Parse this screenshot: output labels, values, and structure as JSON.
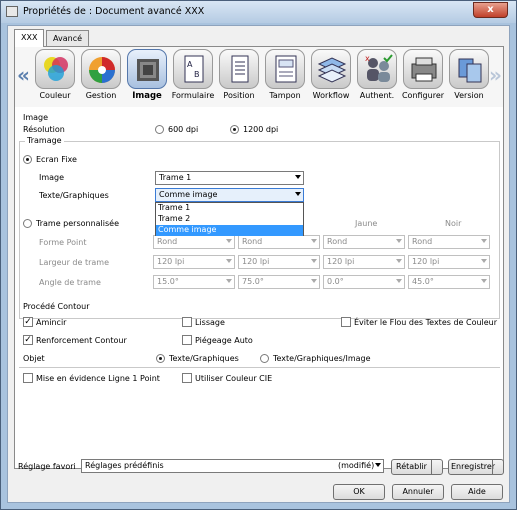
{
  "window": {
    "title": "Propriétés de : Document avancé XXX",
    "close_glyph": "x"
  },
  "tabs": [
    {
      "label": "XXX"
    },
    {
      "label": "Avancé"
    }
  ],
  "toolbar": {
    "prev_glyph": "«",
    "next_glyph": "»",
    "items": [
      {
        "label": "Couleur",
        "icon": "color-circles-icon"
      },
      {
        "label": "Gestion",
        "icon": "color-wheel-icon"
      },
      {
        "label": "Image",
        "icon": "image-halftone-icon"
      },
      {
        "label": "Formulaire",
        "icon": "form-icon"
      },
      {
        "label": "Position",
        "icon": "position-icon"
      },
      {
        "label": "Tampon",
        "icon": "stamp-icon"
      },
      {
        "label": "Workflow",
        "icon": "workflow-icon"
      },
      {
        "label": "Authent.",
        "icon": "users-icon"
      },
      {
        "label": "Configurer",
        "icon": "printer-icon"
      },
      {
        "label": "Version",
        "icon": "version-icon"
      }
    ]
  },
  "image_section": {
    "heading": "Image",
    "resolution_label": "Résolution",
    "res_600": "600 dpi",
    "res_1200": "1200 dpi",
    "tramage": {
      "heading": "Tramage",
      "ecran_fixe": "Ecran Fixe",
      "image_label": "Image",
      "image_value": "Trame 1",
      "texte_label": "Texte/Graphiques",
      "texte_value": "Comme image",
      "dropdown_options": [
        "Trame 1",
        "Trame 2",
        "Comme image"
      ],
      "custom": "Trame personnalisée",
      "col_jaune": "Jaune",
      "col_noir": "Noir",
      "rows": [
        {
          "label": "Forme Point",
          "values": [
            "Rond",
            "Rond",
            "Rond",
            "Rond"
          ]
        },
        {
          "label": "Largeur de trame",
          "values": [
            "120 lpi",
            "120 lpi",
            "120 lpi",
            "120 lpi"
          ]
        },
        {
          "label": "Angle de trame",
          "values": [
            "15.0°",
            "75.0°",
            "0.0°",
            "45.0°"
          ]
        }
      ]
    }
  },
  "contour": {
    "heading": "Procédé Contour",
    "amincir": "Amincir",
    "lissage": "Lissage",
    "eviter": "Éviter le Flou des Textes de Couleur",
    "renforcement": "Renforcement Contour",
    "piegeage": "Piégeage Auto",
    "objet_label": "Objet",
    "objet_texte": "Texte/Graphiques",
    "objet_texte_img": "Texte/Graphiques/Image"
  },
  "misc": {
    "ligne": "Mise en évidence Ligne 1 Point",
    "cie": "Utiliser Couleur CIE"
  },
  "favorites": {
    "label": "Réglage favori",
    "value": "Réglages prédéfinis",
    "status": "(modifié)",
    "restore": "Rétablir",
    "save": "Enregistrer"
  },
  "footer": {
    "ok": "OK",
    "cancel": "Annuler",
    "help": "Aide"
  }
}
